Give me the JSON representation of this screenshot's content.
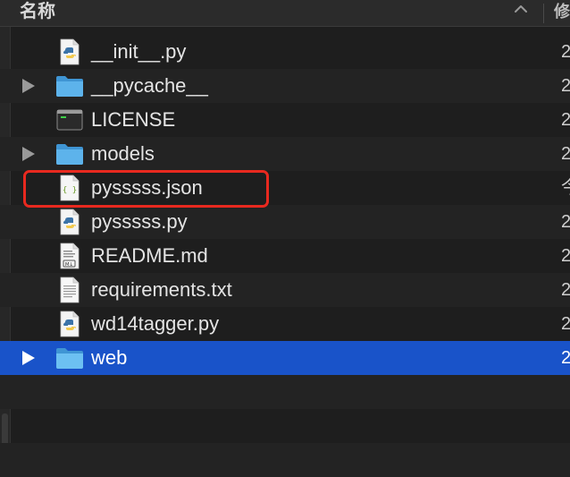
{
  "header": {
    "name_column": "名称",
    "next_column": "修"
  },
  "files": [
    {
      "name": "__init__.py",
      "icon": "python-file-icon",
      "expandable": false,
      "date": "2"
    },
    {
      "name": "__pycache__",
      "icon": "folder-icon",
      "expandable": true,
      "date": "2"
    },
    {
      "name": "LICENSE",
      "icon": "terminal-file-icon",
      "expandable": false,
      "date": "2"
    },
    {
      "name": "models",
      "icon": "folder-icon",
      "expandable": true,
      "date": "2"
    },
    {
      "name": "pysssss.json",
      "icon": "json-file-icon",
      "expandable": false,
      "date": "今"
    },
    {
      "name": "pysssss.py",
      "icon": "python-file-icon",
      "expandable": false,
      "date": "2"
    },
    {
      "name": "README.md",
      "icon": "markdown-file-icon",
      "expandable": false,
      "date": "2"
    },
    {
      "name": "requirements.txt",
      "icon": "text-file-icon",
      "expandable": false,
      "date": "2"
    },
    {
      "name": "wd14tagger.py",
      "icon": "python-file-icon",
      "expandable": false,
      "date": "2"
    },
    {
      "name": "web",
      "icon": "folder-icon",
      "expandable": true,
      "date": "2",
      "selected": true
    }
  ],
  "colors": {
    "selection": "#1953c9",
    "highlight_outline": "#e8291f",
    "folder": "#4aa3df"
  }
}
